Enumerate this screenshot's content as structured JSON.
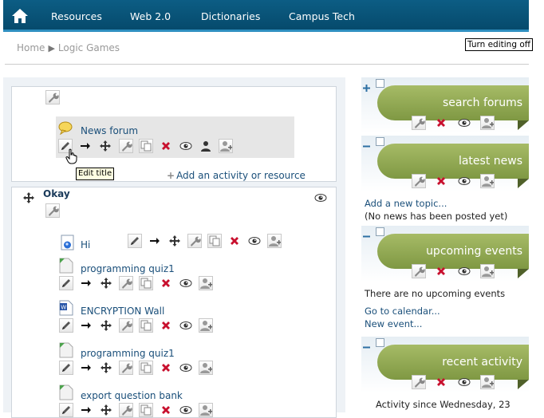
{
  "nav": {
    "home_icon": "home-icon",
    "items": [
      {
        "label": "Resources"
      },
      {
        "label": "Web 2.0"
      },
      {
        "label": "Dictionaries"
      },
      {
        "label": "Campus Tech"
      }
    ]
  },
  "breadcrumb": {
    "home": "Home",
    "separator": "▶",
    "current": "Logic Games"
  },
  "editing_button": "Turn editing off",
  "section0": {
    "news_forum": "News forum",
    "tooltip": "Edit title",
    "add_activity": "Add an activity or resource"
  },
  "section1": {
    "title": "Okay",
    "activities": [
      {
        "name": "Hi",
        "type": "page"
      },
      {
        "name": "programming quiz1",
        "type": "quiz"
      },
      {
        "name": "ENCRYPTION Wall",
        "type": "word-document"
      },
      {
        "name": "programming quiz1",
        "type": "quiz"
      },
      {
        "name": "export question bank",
        "type": "quiz"
      }
    ]
  },
  "blocks": {
    "search_forums": {
      "title": "search forums"
    },
    "latest_news": {
      "title": "latest news",
      "add_topic": "Add a new topic...",
      "no_news": "(No news has been posted yet)"
    },
    "upcoming_events": {
      "title": "upcoming events",
      "no_events": "There are no upcoming events",
      "calendar": "Go to calendar...",
      "new_event": "New event..."
    },
    "recent_activity": {
      "title": "recent activity",
      "since": "Activity since Wednesday, 23"
    }
  },
  "colors": {
    "nav_bg": "#064a6c",
    "block_green": "#8ea64f",
    "link": "#1a4f7a"
  }
}
